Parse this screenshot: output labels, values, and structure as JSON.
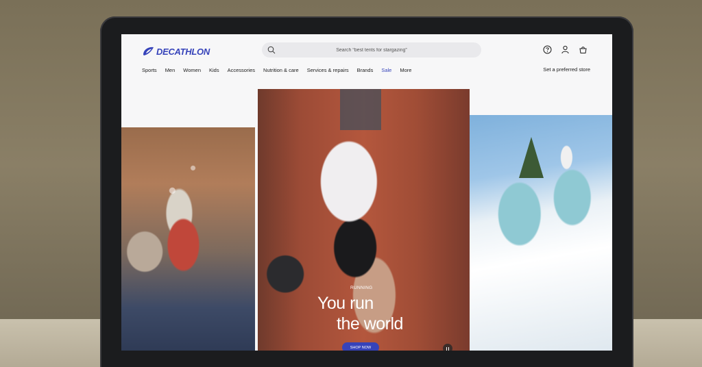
{
  "brand": {
    "name": "DECATHLON",
    "color": "#3643ba"
  },
  "search": {
    "placeholder": "Search “best tents for stargazing”"
  },
  "header_icons": [
    "help-icon",
    "account-icon",
    "cart-icon"
  ],
  "nav": {
    "items": [
      "Sports",
      "Men",
      "Women",
      "Kids",
      "Accessories",
      "Nutrition & care",
      "Services & repairs",
      "Brands",
      "Sale",
      "More"
    ],
    "store": "Set a preferred store"
  },
  "hero": {
    "eyebrow": "RUNNING",
    "line1": "You run",
    "line2": "the world",
    "cta": "SHOP NOW"
  }
}
